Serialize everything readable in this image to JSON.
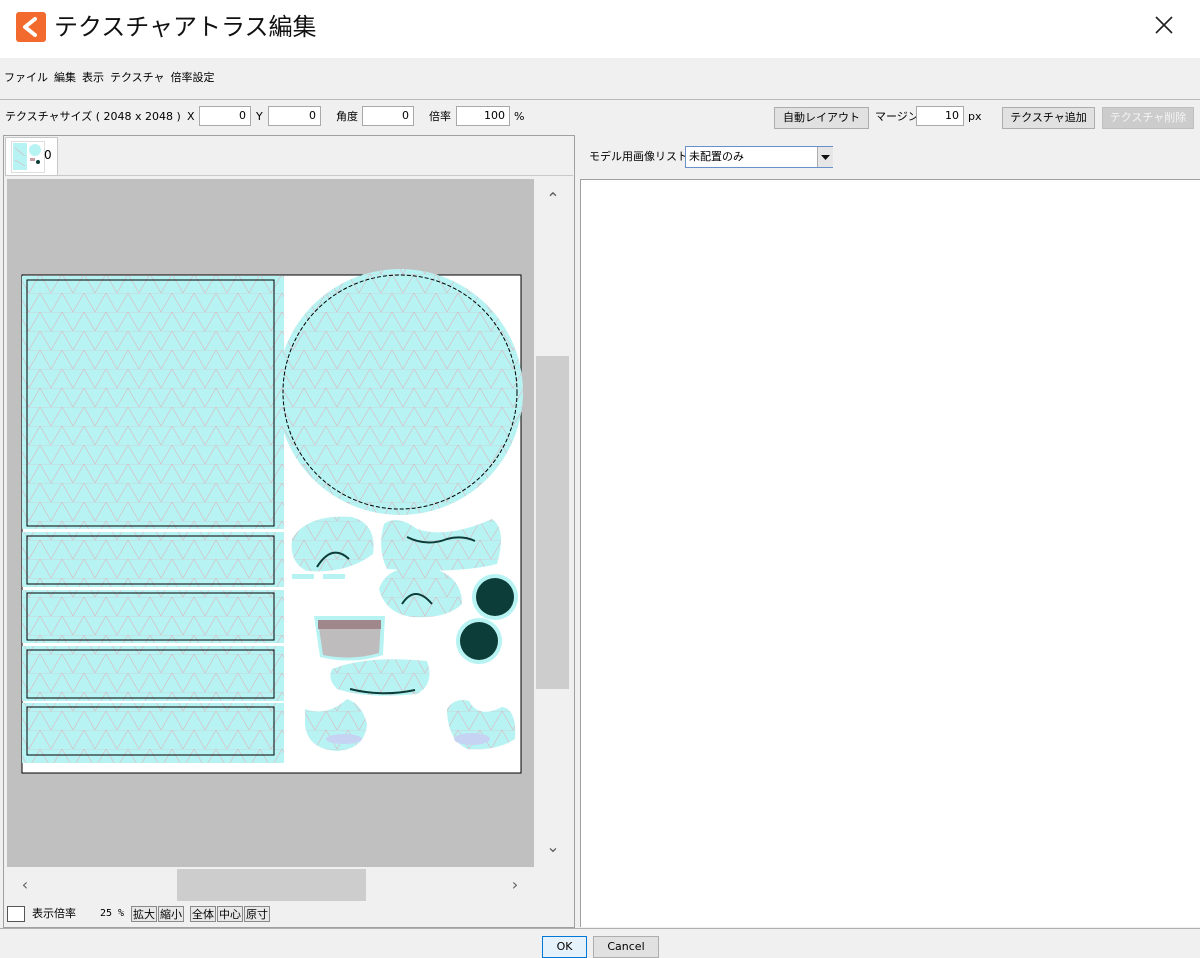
{
  "window": {
    "title": "テクスチャアトラス編集",
    "accent_color": "#f26a2e"
  },
  "menu": [
    "ファイル",
    "編集",
    "表示",
    "テクスチャ",
    "倍率設定"
  ],
  "toolbar": {
    "texture_size_label": "テクスチャサイズ ( 2048 x 2048 )",
    "x_label": "X",
    "x_value": "0",
    "y_label": "Y",
    "y_value": "0",
    "angle_label": "角度",
    "angle_value": "0",
    "scale_label": "倍率",
    "scale_value": "100",
    "scale_unit": "%",
    "auto_layout_button": "自動レイアウト",
    "margin_label": "マージン",
    "margin_value": "10",
    "margin_unit": "px",
    "add_texture_button": "テクスチャ追加",
    "delete_texture_button": "テクスチャ削除"
  },
  "texture_tab": {
    "label": "0"
  },
  "zoom_bar": {
    "label": "表示倍率",
    "value": "25 %",
    "buttons": [
      "拡大",
      "縮小",
      "全体",
      "中心",
      "原寸"
    ]
  },
  "right_panel": {
    "list_label": "モデル用画像リスト",
    "filter_selected": "未配置のみ"
  },
  "footer": {
    "ok": "OK",
    "cancel": "Cancel"
  },
  "colors": {
    "uv_fill": "#b8f3f3",
    "mesh_line": "#d9b6bf",
    "eye_dark": "#0d3d38",
    "grey_area": "#c0c0c0"
  }
}
